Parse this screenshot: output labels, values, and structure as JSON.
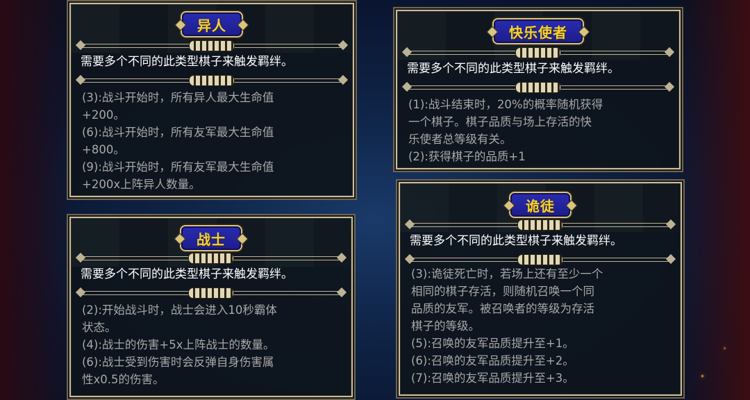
{
  "panels": {
    "yiren": {
      "title": "异人",
      "requirement": "需要多个不同的此类型棋子来触发羁绊。",
      "effects": [
        "(3):战斗开始时，所有异人最大生命值",
        "+200。",
        "(6):战斗开始时，所有友军最大生命值",
        "+800。",
        "(9):战斗开始时，所有友军最大生命值",
        "+200x上阵异人数量。"
      ]
    },
    "kuaile": {
      "title": "快乐使者",
      "requirement": "需要多个不同的此类型棋子来触发羁绊。",
      "effects": [
        "(1):战斗结束时，20%的概率随机获得",
        "一个棋子。棋子品质与场上存活的快",
        "乐使者总等级有关。",
        "(2):获得棋子的品质+1"
      ]
    },
    "zhanshi": {
      "title": "战士",
      "requirement": "需要多个不同的此类型棋子来触发羁绊。",
      "effects": [
        "(2):开始战斗时，战士会进入10秒霸体",
        "状态。",
        "(4):战士的伤害+5x上阵战士的数量。",
        "(6):战士受到伤害时会反弹自身伤害属",
        "性x0.5的伤害。"
      ]
    },
    "guitu": {
      "title": "诡徒",
      "requirement": "需要多个不同的此类型棋子来触发羁绊。",
      "effects": [
        "(3):诡徒死亡时，若场上还有至少一个",
        "相同的棋子存活，则随机召唤一个同",
        "品质的友军。被召唤者的等级为存活",
        "棋子的等级。",
        "(5):召唤的友军品质提升至+1。",
        "(6):召唤的友军品质提升至+2。",
        "(7):召唤的友军品质提升至+3。"
      ]
    }
  },
  "colors": {
    "title_text": "#f6d23a",
    "title_plate": "#2a2bb0",
    "panel_border": "#c9bfa2",
    "requirement_text": "#ffffff",
    "effect_text": "#a8a8a8"
  }
}
